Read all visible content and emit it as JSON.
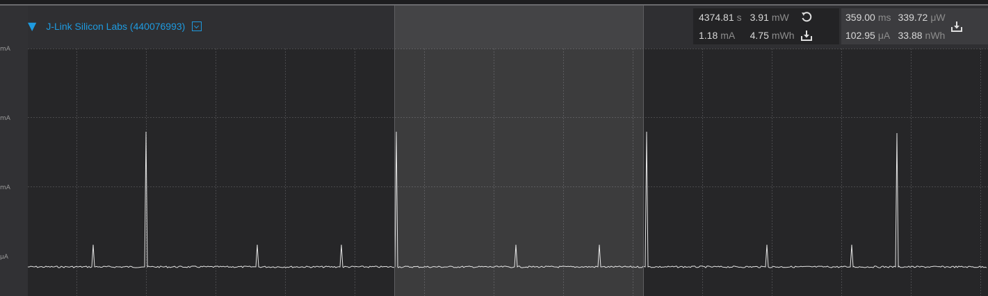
{
  "device": {
    "label": "J-Link Silicon Labs (440076993)"
  },
  "y_axis": {
    "ticks": [
      "mA",
      "mA",
      "mA",
      "μA"
    ]
  },
  "stats_total": {
    "time": {
      "value": "4374.81",
      "unit": "s"
    },
    "current": {
      "value": "1.18",
      "unit": "mA"
    },
    "power": {
      "value": "3.91",
      "unit": "mW"
    },
    "energy": {
      "value": "4.75",
      "unit": "mWh"
    }
  },
  "stats_selection": {
    "duration": {
      "value": "359.00",
      "unit": "ms"
    },
    "current": {
      "value": "102.95",
      "unit": "μA"
    },
    "power": {
      "value": "339.72",
      "unit": "μW"
    },
    "energy": {
      "value": "33.88",
      "unit": "nWh"
    }
  },
  "icons": [
    "reset-icon",
    "export-icon"
  ],
  "colors": {
    "accent": "#1e9be0",
    "trace": "#e6e6e6",
    "plot_bg": "#262628"
  }
}
